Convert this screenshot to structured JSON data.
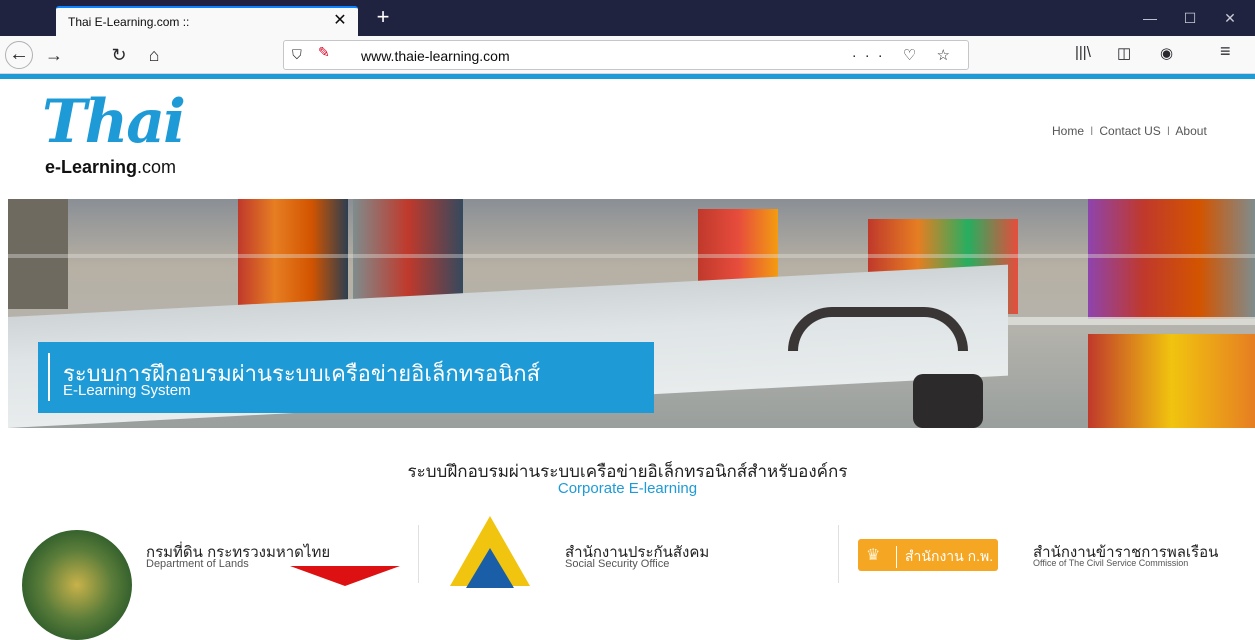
{
  "browser": {
    "tab_title": "Thai E-Learning.com ::",
    "tab_close": "✕",
    "new_tab": "+",
    "url": "www.thaie-learning.com",
    "url_actions": "··· ♡ ☆",
    "window_controls": {
      "minimize": "—",
      "maximize": "☐",
      "close": "✕"
    },
    "nav": {
      "back": "←",
      "forward": "→",
      "reload": "↻",
      "home": "⌂"
    },
    "toolbar": {
      "library": "|||\\",
      "sidebar": "◫",
      "account": "◉",
      "menu": "≡"
    }
  },
  "header": {
    "logo_main": "Thai",
    "logo_sub_bold": "e-Learning",
    "logo_sub_rest": ".com",
    "nav": [
      {
        "label": "Home"
      },
      {
        "label": "Contact US"
      },
      {
        "label": "About"
      }
    ],
    "nav_sep": "l"
  },
  "hero": {
    "title_th": "ระบบการฝึกอบรมผ่านระบบเครือข่ายอิเล็กทรอนิกส์",
    "title_en": "E-Learning System"
  },
  "corporate": {
    "title_th": "ระบบฝึกอบรมผ่านระบบเครือข่ายอิเล็กทรอนิกส์สำหรับองค์กร",
    "title_en": "Corporate E-learning",
    "orgs": [
      {
        "name_th": "กรมที่ดิน กระทรวงมหาดไทย",
        "name_en": "Department of Lands"
      },
      {
        "name_th": "สำนักงานประกันสังคม",
        "name_en": "Social Security Office"
      },
      {
        "name_th": "สำนักงานข้าราชการพลเรือน",
        "name_en": "Office of The Civil Service Commission",
        "badge": "สำนักงาน ก.พ."
      }
    ]
  },
  "colors": {
    "accent": "#1e9bd7",
    "titlebar": "#202340"
  }
}
